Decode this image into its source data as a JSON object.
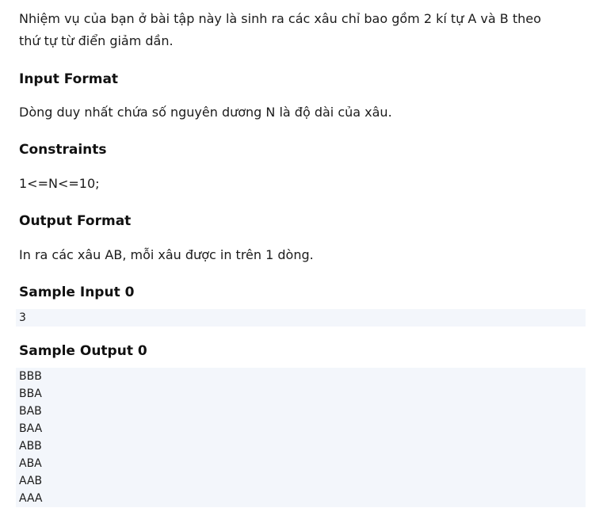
{
  "intro": {
    "line1": "Nhiệm vụ của bạn ở bài tập này là sinh ra các xâu chỉ bao gồm 2 kí tự A và B theo",
    "line2": "thứ tự từ điển giảm dần."
  },
  "input_format": {
    "heading": "Input Format",
    "text": "Dòng duy nhất chứa số nguyên dương N là độ dài của xâu."
  },
  "constraints": {
    "heading": "Constraints",
    "text": "1<=N<=10;"
  },
  "output_format": {
    "heading": "Output Format",
    "text": "In ra các xâu AB, mỗi xâu được in trên 1 dòng."
  },
  "sample_input": {
    "heading": "Sample Input 0",
    "lines": [
      "3"
    ]
  },
  "sample_output": {
    "heading": "Sample Output 0",
    "lines": [
      "BBB",
      "BBA",
      "BAB",
      "BAA",
      "ABB",
      "ABA",
      "AAB",
      "AAA"
    ]
  }
}
